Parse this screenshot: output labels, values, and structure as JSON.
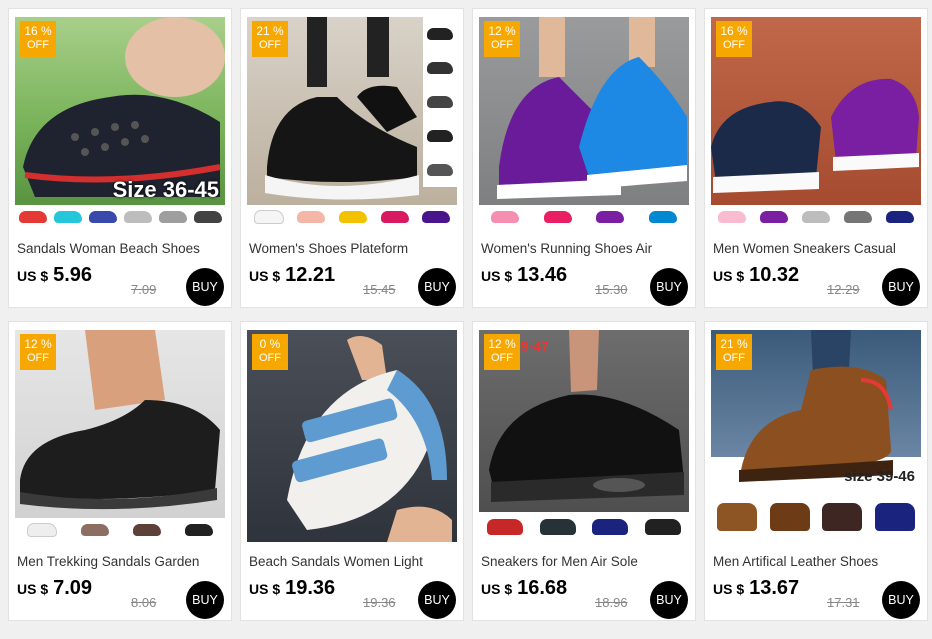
{
  "currency": "US $",
  "buy_label": "BUY",
  "discount_suffix": "%",
  "off_label": "OFF",
  "products": [
    {
      "title": "Sandals Woman Beach Shoes",
      "price": "5.96",
      "original_price": "7.09",
      "discount": "16",
      "size_label": "Size 36-45",
      "icon": "clog-sandal-icon",
      "colors": [
        "#e53935",
        "#26c6da",
        "#3949ab",
        "#bdbdbd",
        "#9e9e9e",
        "#424242"
      ]
    },
    {
      "title": "Women's Shoes Plateform",
      "price": "12.21",
      "original_price": "15.45",
      "discount": "21",
      "icon": "platform-sneaker-icon",
      "colors": [
        "#f5f5f5",
        "#f4b6a6",
        "#f2c200",
        "#d81b60",
        "#4a148c"
      ]
    },
    {
      "title": "Women's Running Shoes Air",
      "price": "13.46",
      "original_price": "15.30",
      "discount": "12",
      "icon": "running-shoe-icon",
      "colors": [
        "#f48fb1",
        "#e91e63",
        "#7b1fa2",
        "#0288d1"
      ]
    },
    {
      "title": "Men Women Sneakers Casual",
      "price": "10.32",
      "original_price": "12.29",
      "discount": "16",
      "icon": "slip-on-sneaker-icon",
      "colors": [
        "#f8bbd0",
        "#7b1fa2",
        "#bdbdbd",
        "#757575",
        "#1a237e"
      ]
    },
    {
      "title": "Men Trekking Sandals Garden",
      "price": "7.09",
      "original_price": "8.06",
      "discount": "12",
      "icon": "garden-clog-icon",
      "colors": [
        "#eeeeee",
        "#8d6e63",
        "#5d4037",
        "#212121"
      ]
    },
    {
      "title": "Beach Sandals Women Light",
      "price": "19.36",
      "original_price": "19.36",
      "discount": "0",
      "icon": "sport-sandal-icon",
      "colors": []
    },
    {
      "title": "Sneakers for Men Air Sole",
      "price": "16.68",
      "original_price": "18.96",
      "discount": "12",
      "size_label": "39-47",
      "icon": "air-sneaker-icon",
      "colors": [
        "#c62828",
        "#263238",
        "#1a237e",
        "#212121"
      ]
    },
    {
      "title": "Men Artifical Leather Shoes",
      "price": "13.67",
      "original_price": "17.31",
      "discount": "21",
      "size_label": "size 39-46",
      "icon": "leather-boot-icon",
      "colors": [
        "#8d5524",
        "#6d3b16",
        "#3e2723",
        "#1a237e"
      ]
    }
  ]
}
